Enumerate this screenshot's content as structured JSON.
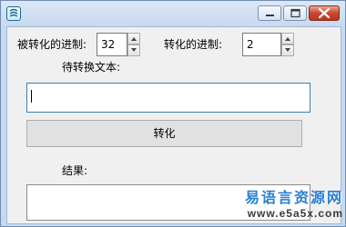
{
  "window": {
    "controls": {
      "minimize_icon": "minimize-icon",
      "maximize_icon": "maximize-icon",
      "close_icon": "close-icon"
    }
  },
  "form": {
    "source_base_label": "被转化的进制:",
    "source_base_value": "32",
    "target_base_label": "转化的进制:",
    "target_base_value": "2",
    "input_label": "待转换文本:",
    "input_value": "",
    "convert_button": "转化",
    "result_label": "结果:",
    "result_value": ""
  },
  "watermark": {
    "brand": "易语言资源网",
    "url": "www.e5a5x.com"
  },
  "colors": {
    "title_bar": "#c7d9ee",
    "close_button": "#c9482f",
    "client_background": "#f0f0f0",
    "watermark_text": "#2c7fd6"
  }
}
